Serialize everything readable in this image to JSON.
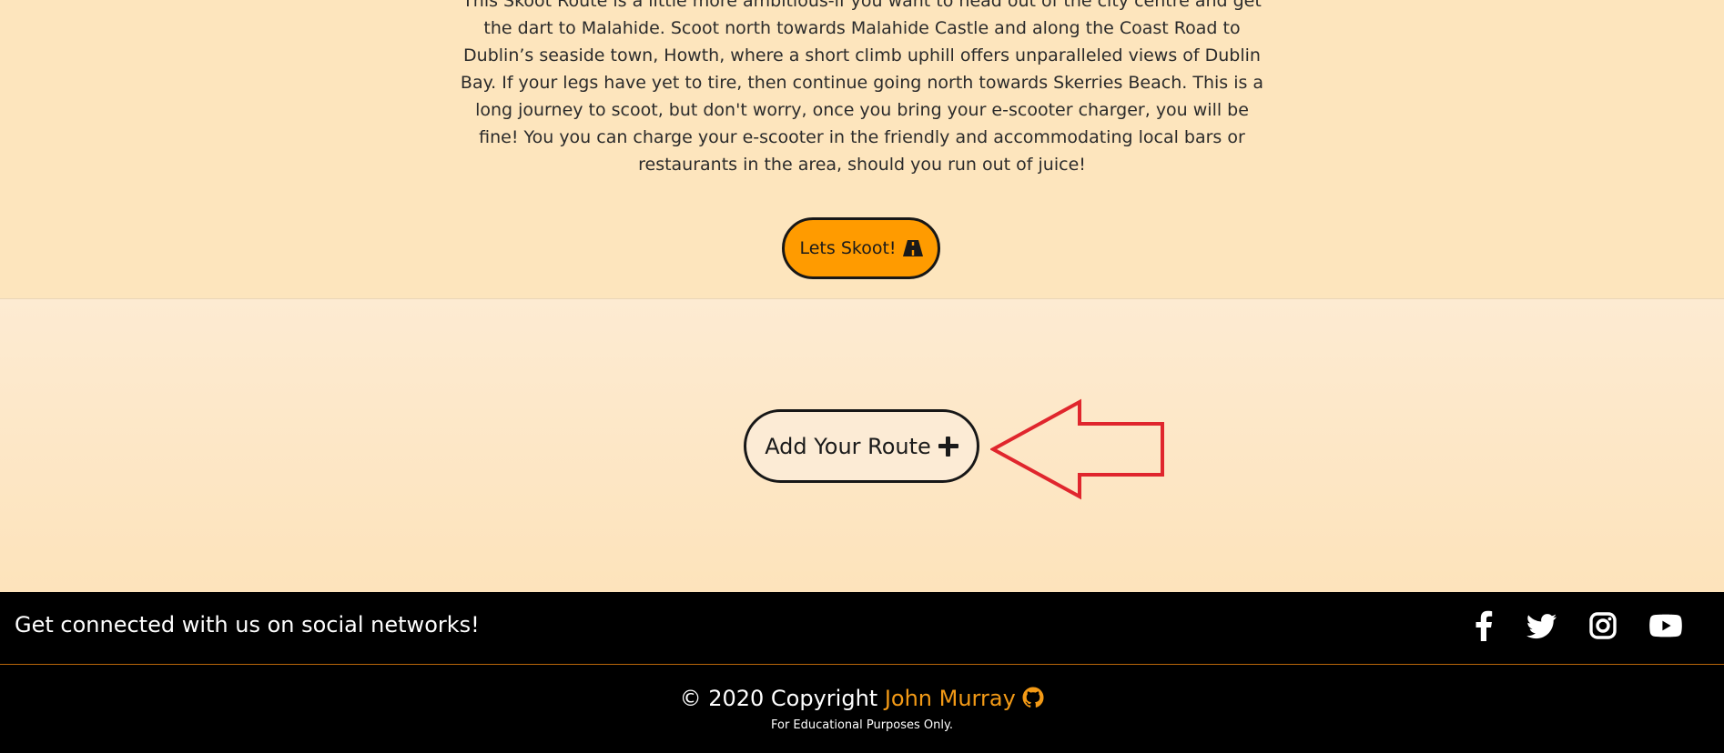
{
  "route": {
    "description": "This Skoot Route is a little more ambitious-if you want to head out of the city centre and get the dart to Malahide. Scoot north towards Malahide Castle and along the Coast Road to Dublin’s seaside town, Howth, where a short climb uphill offers unparalleled views of Dublin Bay. If your legs have yet to tire, then continue going north towards Skerries Beach. This is a long journey to scoot, but don't worry, once you bring your e-scooter charger, you will be fine! You you can charge your e-scooter in the friendly and accommodating local bars or restaurants in the area, should you run out of juice!",
    "button_label": "Lets Skoot!",
    "button_icon": "road-icon",
    "button_color": "#ff9b00"
  },
  "add_route": {
    "button_label": "Add Your Route",
    "button_icon": "plus-icon",
    "arrow_annotation_color": "#e0262d"
  },
  "social": {
    "heading": "Get connected with us on social networks!",
    "icons": [
      "facebook-icon",
      "twitter-icon",
      "instagram-icon",
      "youtube-icon"
    ]
  },
  "footer": {
    "copyright_prefix": "© 2020 Copyright",
    "author": "John Murray",
    "author_icon": "github-icon",
    "note": "For Educational Purposes Only.",
    "accent_color": "#f39a16"
  }
}
